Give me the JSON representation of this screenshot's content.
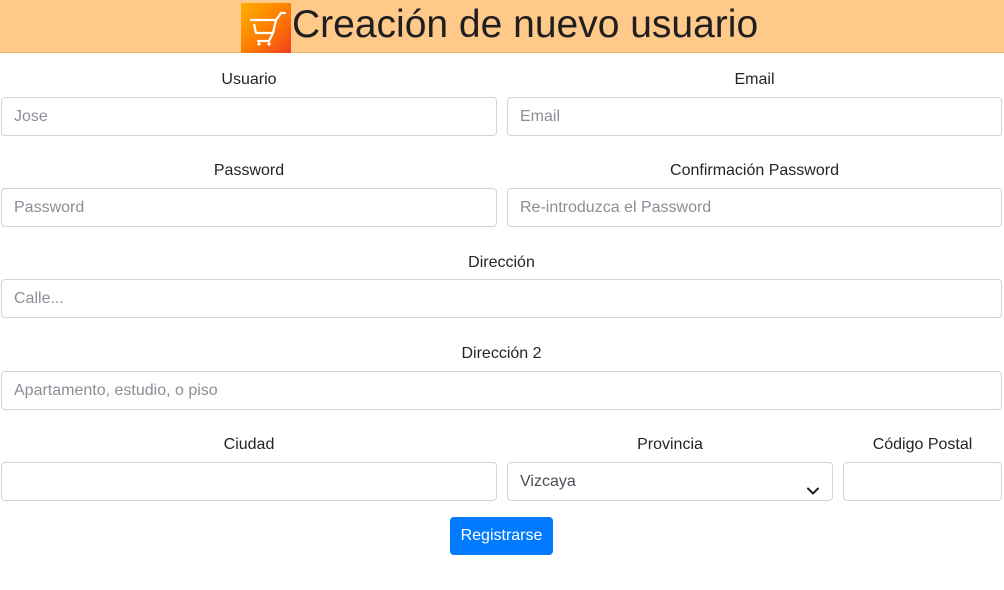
{
  "header": {
    "title": "Creación de nuevo usuario",
    "logo_icon": "shopping-cart-icon"
  },
  "form": {
    "usuario": {
      "label": "Usuario",
      "placeholder": "Jose",
      "value": ""
    },
    "email": {
      "label": "Email",
      "placeholder": "Email",
      "value": ""
    },
    "password": {
      "label": "Password",
      "placeholder": "Password",
      "value": ""
    },
    "confirm_password": {
      "label": "Confirmación Password",
      "placeholder": "Re-introduzca el Password",
      "value": ""
    },
    "direccion": {
      "label": "Dirección",
      "placeholder": "Calle...",
      "value": ""
    },
    "direccion2": {
      "label": "Dirección 2",
      "placeholder": "Apartamento, estudio, o piso",
      "value": ""
    },
    "ciudad": {
      "label": "Ciudad",
      "placeholder": "",
      "value": ""
    },
    "provincia": {
      "label": "Provincia",
      "selected": "Vizcaya"
    },
    "codigo_postal": {
      "label": "Código Postal",
      "placeholder": "",
      "value": ""
    },
    "submit_label": "Registrarse"
  },
  "colors": {
    "header_bg": "#ffc98a",
    "button_bg": "#007bff",
    "input_border": "#ced4da"
  }
}
